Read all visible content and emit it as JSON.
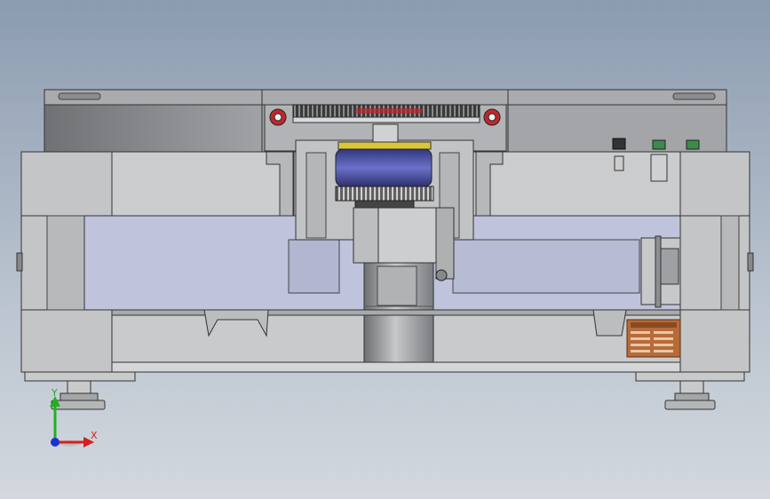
{
  "view": {
    "background_top": "#8b9bb0",
    "background_bottom": "#d3d8de"
  },
  "model": {
    "base_color": "#c9cacb",
    "top_plate_color": "#9c9ea1",
    "inner_panel_color": "#bfc3dc",
    "gear_color": "#2c2c2c",
    "motor_color": "#4a4f9a",
    "accent_red": "#c0272d",
    "accent_yellow": "#d9c63a",
    "accent_green": "#3e8a4a",
    "nameplate_color": "#b86b3a"
  },
  "triad": {
    "x_label": "X",
    "y_label": "Y",
    "x_color": "#d42020",
    "y_color": "#21b021",
    "z_color": "#2030d0"
  }
}
